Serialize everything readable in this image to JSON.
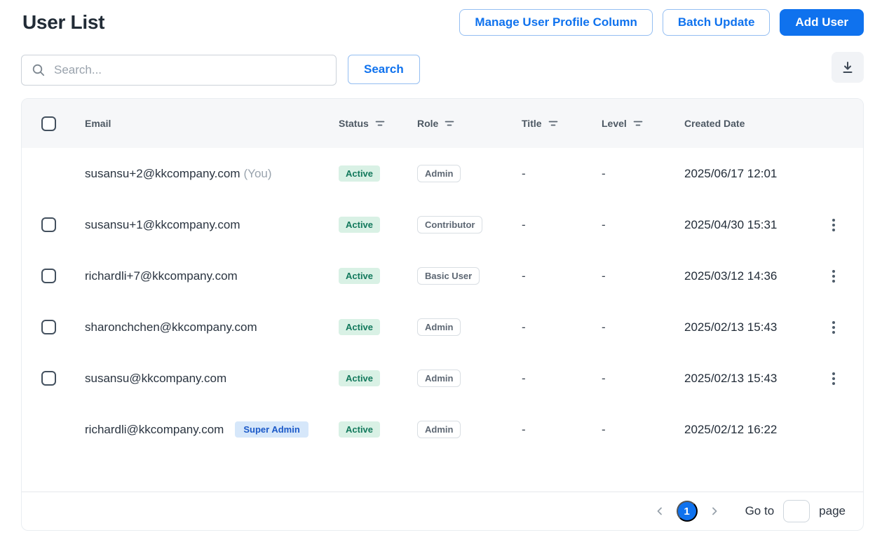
{
  "page": {
    "title": "User List"
  },
  "toolbar": {
    "manage_user_profile_column_label": "Manage User Profile Column",
    "batch_update_label": "Batch Update",
    "add_user_label": "Add User"
  },
  "search": {
    "placeholder": "Search...",
    "value": "",
    "button_label": "Search"
  },
  "export": {
    "icon": "download-icon"
  },
  "table": {
    "columns": [
      {
        "label": "Email",
        "filterable": false
      },
      {
        "label": "Status",
        "filterable": true
      },
      {
        "label": "Role",
        "filterable": true
      },
      {
        "label": "Title",
        "filterable": true
      },
      {
        "label": "Level",
        "filterable": true
      },
      {
        "label": "Created Date",
        "filterable": false
      }
    ],
    "rows": [
      {
        "email": "susansu+2@kkcompany.com",
        "email_suffix": "(You)",
        "badge": "",
        "status": "Active",
        "role": "Admin",
        "title": "-",
        "level": "-",
        "created_date": "2025/06/17 12:01",
        "selectable": false,
        "has_actions": false
      },
      {
        "email": "susansu+1@kkcompany.com",
        "email_suffix": "",
        "badge": "",
        "status": "Active",
        "role": "Contributor",
        "title": "-",
        "level": "-",
        "created_date": "2025/04/30 15:31",
        "selectable": true,
        "has_actions": true
      },
      {
        "email": "richardli+7@kkcompany.com",
        "email_suffix": "",
        "badge": "",
        "status": "Active",
        "role": "Basic User",
        "title": "-",
        "level": "-",
        "created_date": "2025/03/12 14:36",
        "selectable": true,
        "has_actions": true
      },
      {
        "email": "sharonchchen@kkcompany.com",
        "email_suffix": "",
        "badge": "",
        "status": "Active",
        "role": "Admin",
        "title": "-",
        "level": "-",
        "created_date": "2025/02/13 15:43",
        "selectable": true,
        "has_actions": true
      },
      {
        "email": "susansu@kkcompany.com",
        "email_suffix": "",
        "badge": "",
        "status": "Active",
        "role": "Admin",
        "title": "-",
        "level": "-",
        "created_date": "2025/02/13 15:43",
        "selectable": true,
        "has_actions": true
      },
      {
        "email": "richardli@kkcompany.com",
        "email_suffix": "",
        "badge": "Super Admin",
        "status": "Active",
        "role": "Admin",
        "title": "-",
        "level": "-",
        "created_date": "2025/02/12 16:22",
        "selectable": false,
        "has_actions": false
      }
    ]
  },
  "pagination": {
    "current_page": "1",
    "goto_label": "Go to",
    "page_unit_label": "page",
    "goto_value": ""
  },
  "icons": {
    "search": "search-icon",
    "export": "download-icon",
    "column_filter": "filter-icon",
    "row_actions": "kebab-menu-icon",
    "prev_page": "chevron-left-icon",
    "next_page": "chevron-right-icon"
  },
  "colors": {
    "primary_blue": "#0F72EE",
    "outline_button_border": "#94BEF2",
    "status_active_bg": "#D9F1E5",
    "status_active_text": "#12795C",
    "super_admin_bg": "#D6E7FA",
    "super_admin_text": "#1B59C8",
    "table_header_bg": "#F6F7F9",
    "card_border": "#E9EDF1",
    "title_text": "#212B36"
  }
}
